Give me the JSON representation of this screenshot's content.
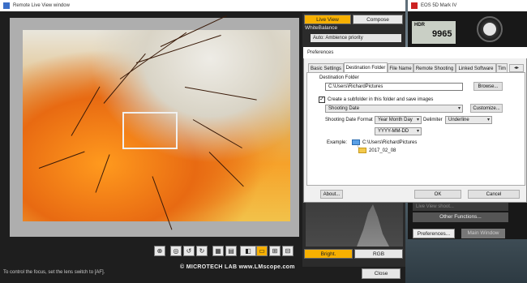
{
  "liveview": {
    "title": "Remote Live View window",
    "status": "To control the focus, set the lens switch to [AF].",
    "close_label": "Close"
  },
  "right_panel": {
    "tab_live_view": "Live View",
    "tab_compose": "Compose",
    "white_balance_label": "WhiteBalance",
    "white_balance_value": "Auto: Ambience priority",
    "bright_label": "Bright.",
    "rgb_label": "RGB"
  },
  "camera": {
    "title": "EOS 5D Mark IV",
    "hdr": "HDR",
    "shots": "9965",
    "live_view_shoot": "Live View shoot...",
    "other_functions": "Other Functions...",
    "preferences_label": "Preferences...",
    "main_window_label": "Main Window"
  },
  "dialog": {
    "title": "Preferences",
    "tabs": [
      "Basic Settings",
      "Destination Folder",
      "File Name",
      "Remote Shooting",
      "Linked Software",
      "Tim"
    ],
    "destination_folder_label": "Destination Folder",
    "destination_path": "C:\\Users\\RichardPictures",
    "browse_label": "Browse...",
    "subfolder_label": "Create a subfolder in this folder and save images",
    "subfolder_checked": "✓",
    "subfolder_type": "Shooting Date",
    "customize_label": "Customize...",
    "date_format_label": "Shooting Date Format",
    "date_format_value": "Year Month Day",
    "delimiter_label": "Delimiter",
    "delimiter_value": "Underline",
    "date_pattern": "YYYY-MM-DD",
    "example_label": "Example:",
    "example_path": "C:\\Users\\RichardPictures",
    "example_folder": "2017_02_08",
    "about_label": "About...",
    "ok_label": "OK",
    "cancel_label": "Cancel"
  },
  "watermark": "© MICROTECH LAB  www.LMscope.com"
}
